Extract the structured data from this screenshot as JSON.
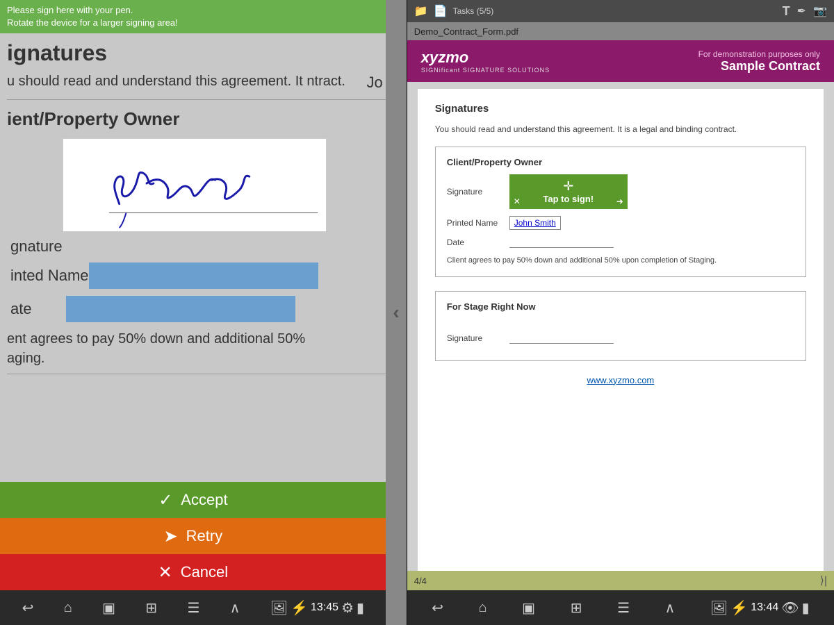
{
  "left": {
    "instruction_line1": "Please sign here with your pen.",
    "instruction_line2": "Rotate the device for a larger signing area!",
    "section_title": "ignatures",
    "agreement_text": "u should read and understand this agreement. It\nntract.",
    "owner_title": "ient/Property Owner",
    "signature_label": "gnature",
    "printed_name_label": "inted Name",
    "date_label": "ate",
    "agreement_bottom1": "ent agrees to pay 50% down and additional 50%",
    "agreement_bottom2": "aging.",
    "btn_accept": "Accept",
    "btn_retry": "Retry",
    "btn_cancel": "Cancel",
    "nav_time": "13:45",
    "jo_text": "Jo"
  },
  "right": {
    "tasks_label": "Tasks (5/5)",
    "filename": "Demo_Contract_Form.pdf",
    "header": {
      "logo_text": "xyzmo",
      "logo_sub": "SIGNificant SIGNATURE SOLUTIONS",
      "demo_note": "For demonstration purposes only",
      "contract_title": "Sample Contract"
    },
    "doc": {
      "signatures_title": "Signatures",
      "agreement_text": "You should read and understand this agreement. It is a legal and binding contract.",
      "client_owner_title": "Client/Property Owner",
      "signature_label": "Signature",
      "tap_to_sign": "Tap to sign!",
      "printed_name_label": "Printed Name",
      "printed_name_value": "John Smith",
      "date_label": "Date",
      "client_note": "Client agrees to pay 50% down and additional 50% upon completion of Staging.",
      "stage_right_title": "For Stage Right Now",
      "stage_signature_label": "Signature",
      "xyzmo_link": "www.xyzmo.com"
    },
    "bottom_bar": {
      "page": "4/4"
    },
    "nav_time": "13:44"
  }
}
